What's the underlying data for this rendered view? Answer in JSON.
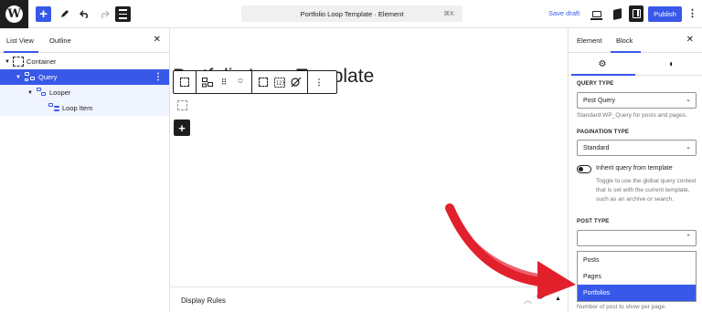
{
  "topbar": {
    "document_title": "Portfolio Loop Template · Element",
    "shortcut": "⌘K",
    "save_draft_label": "Save draft",
    "publish_label": "Publish"
  },
  "left_panel": {
    "tabs": [
      "List View",
      "Outline"
    ],
    "tree": [
      {
        "label": "Container"
      },
      {
        "label": "Query"
      },
      {
        "label": "Looper"
      },
      {
        "label": "Loop Item"
      }
    ]
  },
  "canvas": {
    "title": "Portfolio Loop Template",
    "display_rules_label": "Display Rules"
  },
  "right_panel": {
    "tabs": [
      "Element",
      "Block"
    ],
    "query_type": {
      "label": "QUERY TYPE",
      "value": "Post Query",
      "help": "Standard WP_Query for posts and pages."
    },
    "pagination_type": {
      "label": "PAGINATION TYPE",
      "value": "Standard"
    },
    "inherit_query": {
      "label": "Inherit query from template",
      "help": "Toggle to use the global query context that is set with the current template, such as an archive or search."
    },
    "post_type": {
      "label": "POST TYPE",
      "value": "",
      "options": [
        "Posts",
        "Pages",
        "Portfolios"
      ],
      "selected": "Portfolios"
    },
    "bottom_help": "Number of post to show per page."
  },
  "colors": {
    "accent": "#3858e9",
    "annotation_arrow": "#e2202c"
  }
}
